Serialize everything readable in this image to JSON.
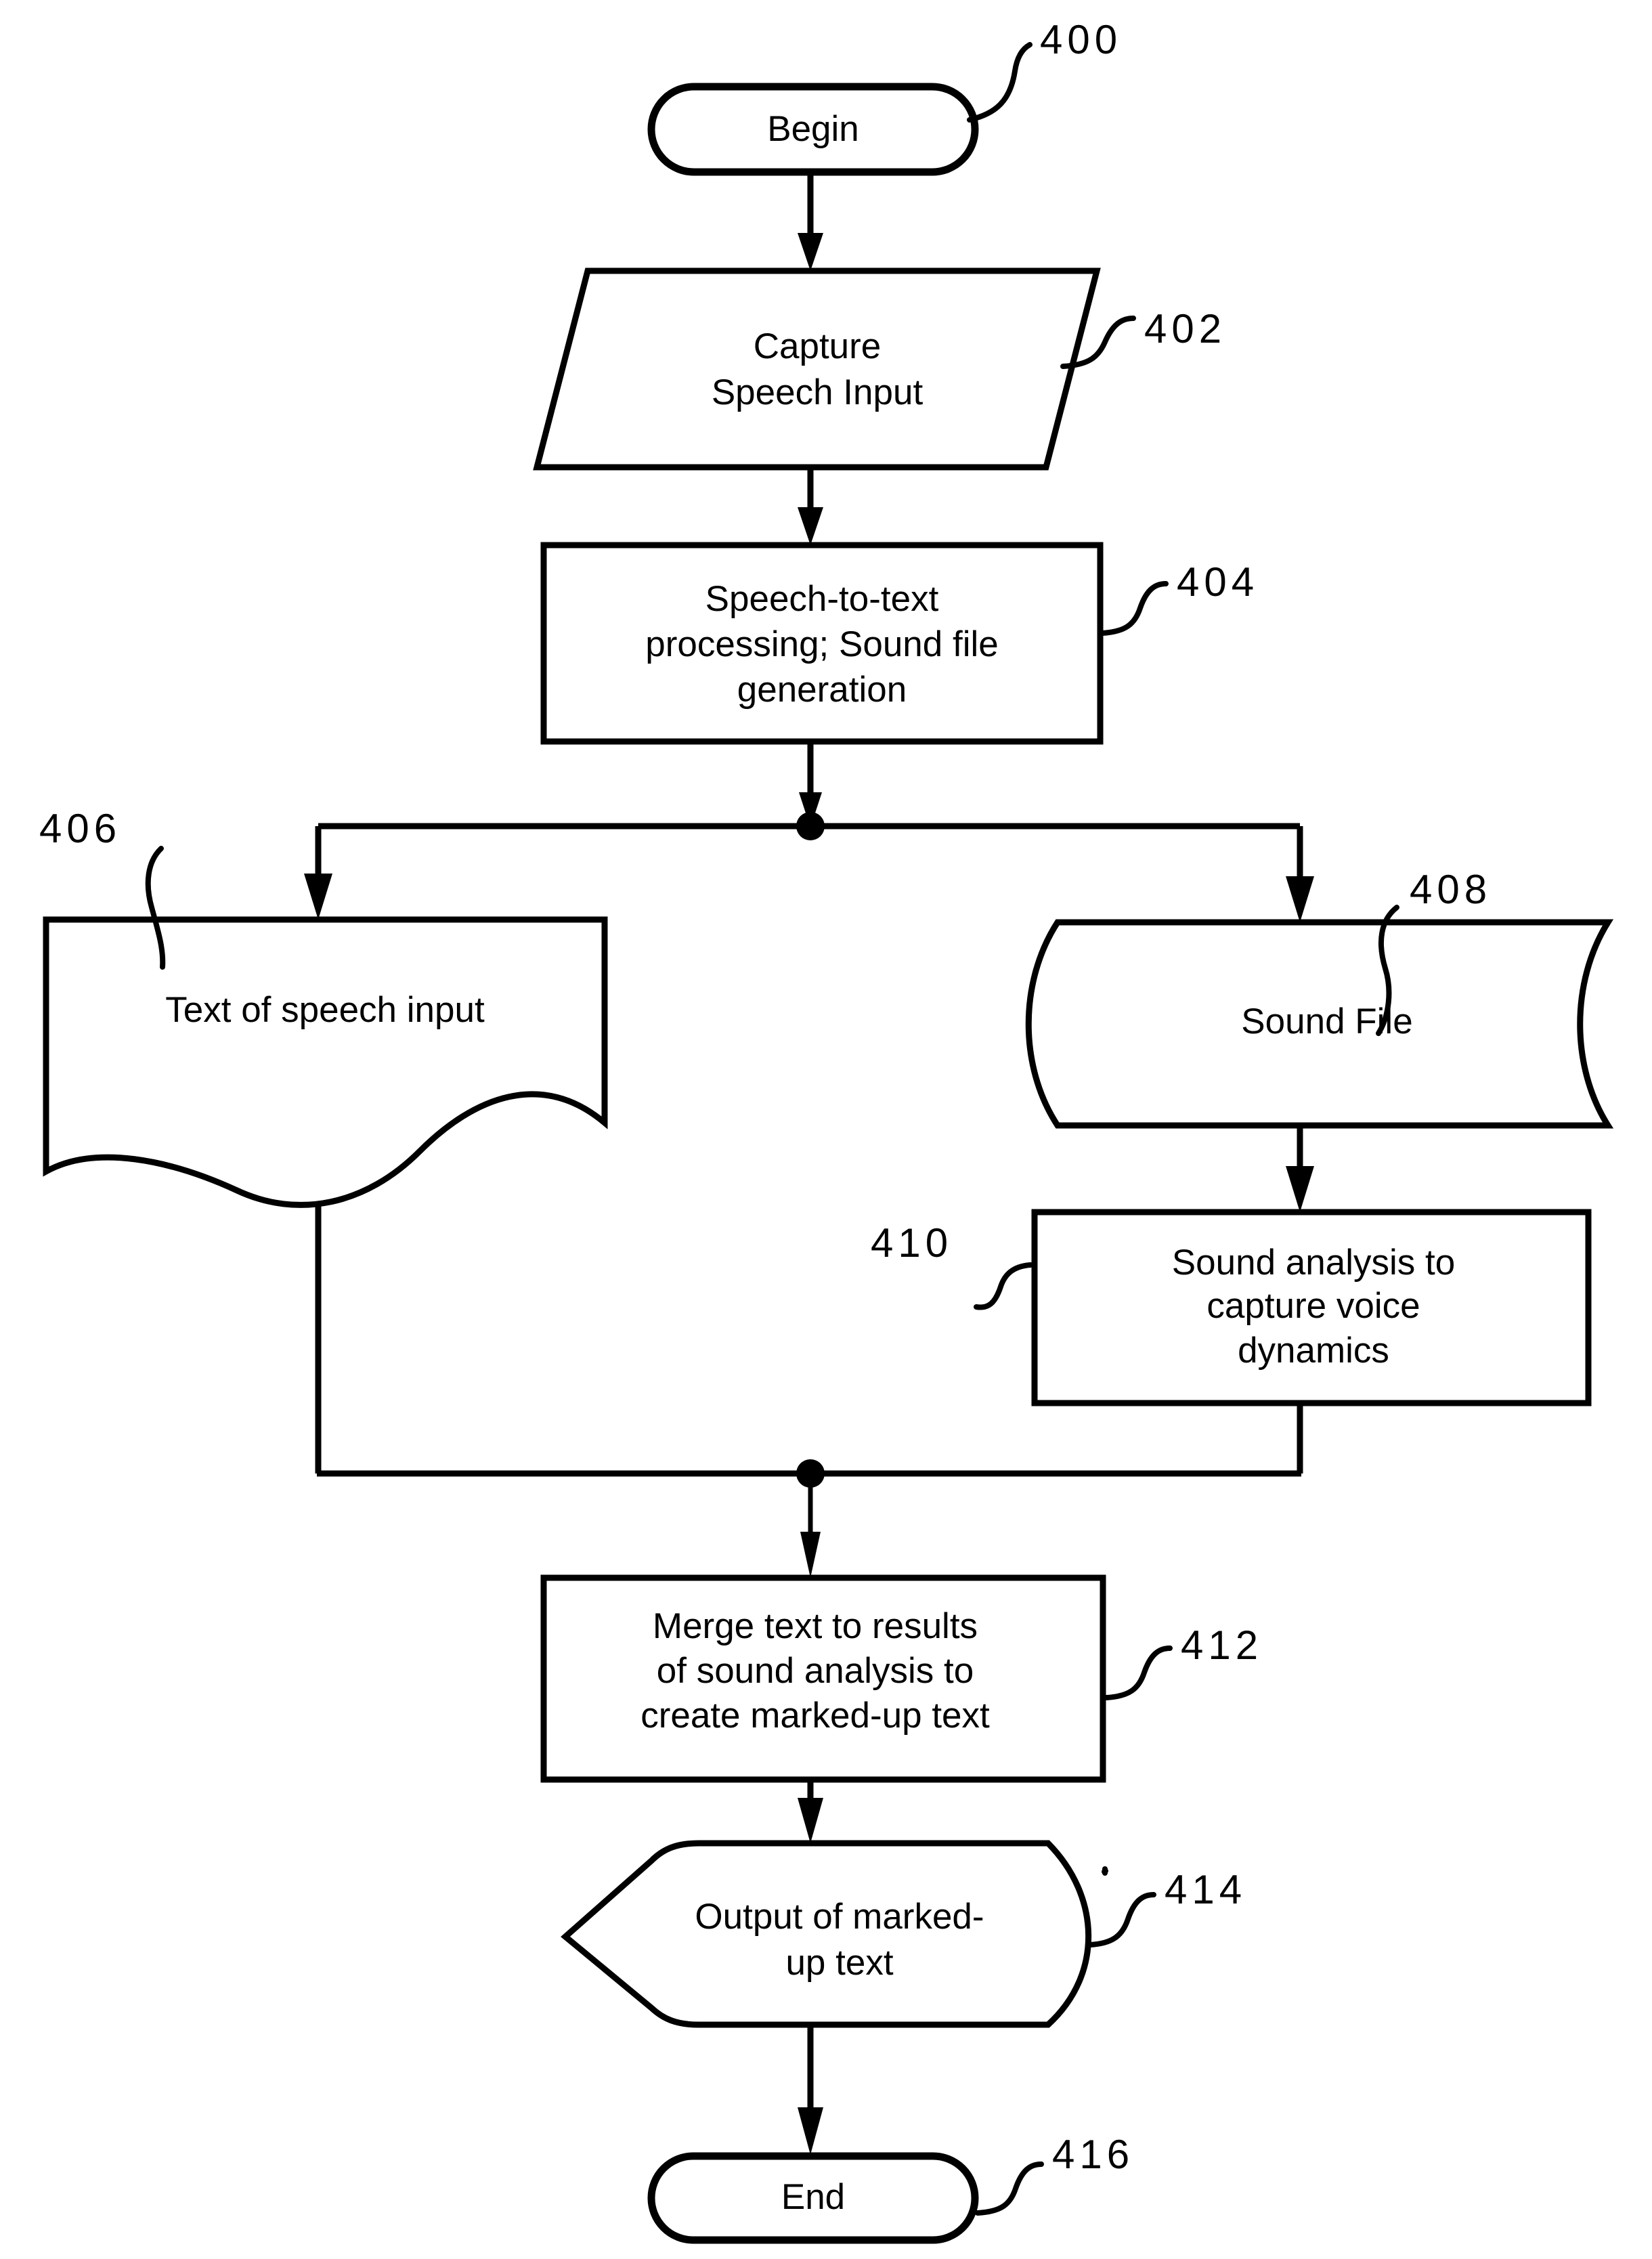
{
  "figure": {
    "kind": "patent-flowchart",
    "ink_color": "#000000",
    "background_color": "#ffffff"
  },
  "nodes": {
    "begin": {
      "ref": "400",
      "shape": "terminator",
      "label": "Begin"
    },
    "capture": {
      "ref": "402",
      "shape": "parallelogram-input",
      "label_line1": "Capture",
      "label_line2": "Speech Input"
    },
    "stt": {
      "ref": "404",
      "shape": "process-rectangle",
      "label_line1": "Speech-to-text",
      "label_line2": "processing; Sound file",
      "label_line3": "generation"
    },
    "text_doc": {
      "ref": "406",
      "shape": "document-wavy",
      "label": "Text of speech input"
    },
    "sound_file": {
      "ref": "408",
      "shape": "stored-data",
      "label": "Sound File"
    },
    "sound_analysis": {
      "ref": "410",
      "shape": "process-rectangle",
      "label_line1": "Sound analysis to",
      "label_line2": "capture voice",
      "label_line3": "dynamics"
    },
    "merge": {
      "ref": "412",
      "shape": "process-rectangle",
      "label_line1": "Merge text to results",
      "label_line2": "of sound analysis to",
      "label_line3": "create marked-up text"
    },
    "output": {
      "ref": "414",
      "shape": "display-output",
      "label_line1": "Output of marked-",
      "label_line2": "up text"
    },
    "end": {
      "ref": "416",
      "shape": "terminator",
      "label": "End"
    }
  },
  "flow": {
    "edges": [
      {
        "from": "begin",
        "to": "capture"
      },
      {
        "from": "capture",
        "to": "stt"
      },
      {
        "from": "stt",
        "to": "split-junction"
      },
      {
        "from": "split-junction",
        "to": "text_doc"
      },
      {
        "from": "split-junction",
        "to": "sound_file"
      },
      {
        "from": "sound_file",
        "to": "sound_analysis"
      },
      {
        "from": "text_doc",
        "to": "merge-junction"
      },
      {
        "from": "sound_analysis",
        "to": "merge-junction"
      },
      {
        "from": "merge-junction",
        "to": "merge"
      },
      {
        "from": "merge",
        "to": "output"
      },
      {
        "from": "output",
        "to": "end"
      }
    ]
  }
}
